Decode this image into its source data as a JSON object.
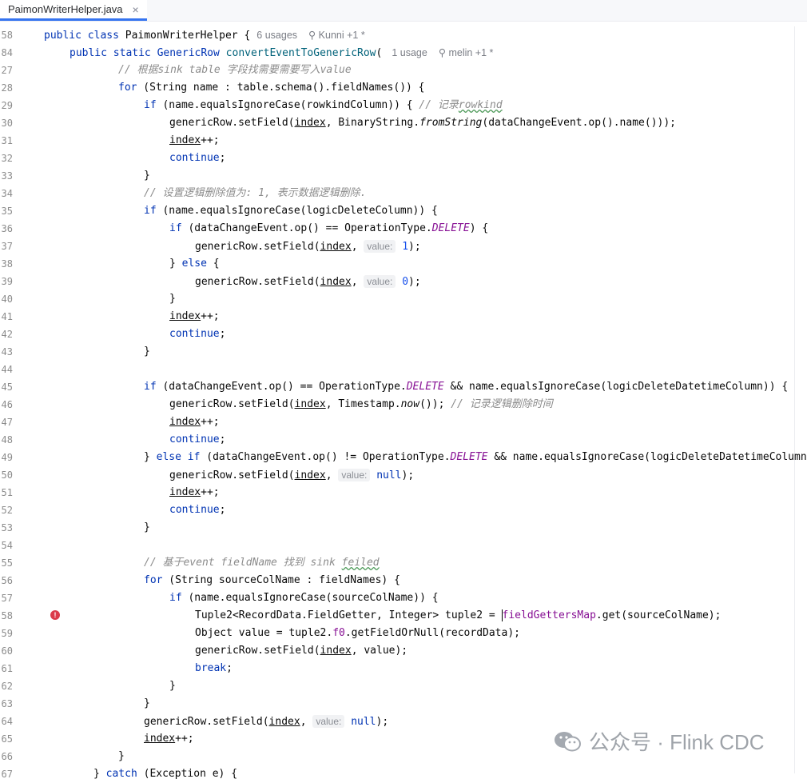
{
  "editor": {
    "tab": {
      "file_name": "PaimonWriterHelper.java",
      "close": "×"
    },
    "sticky": [
      {
        "ln": "58",
        "pre": "public class ",
        "name": "PaimonWriterHelper",
        "post": " {",
        "usages": "6 usages",
        "authors": "Kunni +1 *"
      },
      {
        "ln": "84",
        "pre": "public static GenericRow ",
        "name": "convertEventToGenericRow",
        "post": "(",
        "usages": "1 usage",
        "authors": "melin +1 *"
      }
    ],
    "lines": [
      {
        "ln": "27",
        "t": "// 根据sink table 字段找需要需要写入value"
      },
      {
        "ln": "28",
        "t": "for (String name : table.schema().fieldNames()) {"
      },
      {
        "ln": "29",
        "t": "if (name.equalsIgnoreCase(rowkindColumn)) { // 记录rowkind"
      },
      {
        "ln": "30",
        "t": "genericRow.setField(index, BinaryString.fromString(dataChangeEvent.op().name()));"
      },
      {
        "ln": "31",
        "t": "index++;"
      },
      {
        "ln": "32",
        "t": "continue;"
      },
      {
        "ln": "33",
        "t": "}"
      },
      {
        "ln": "34",
        "t": "// 设置逻辑删除值为: 1, 表示数据逻辑删除."
      },
      {
        "ln": "35",
        "t": "if (name.equalsIgnoreCase(logicDeleteColumn)) {"
      },
      {
        "ln": "36",
        "t": "if (dataChangeEvent.op() == OperationType.DELETE) {"
      },
      {
        "ln": "37",
        "t": "genericRow.setField(index, value: 1);"
      },
      {
        "ln": "38",
        "t": "} else {"
      },
      {
        "ln": "39",
        "t": "genericRow.setField(index, value: 0);"
      },
      {
        "ln": "40",
        "t": "}"
      },
      {
        "ln": "41",
        "t": "index++;"
      },
      {
        "ln": "42",
        "t": "continue;"
      },
      {
        "ln": "43",
        "t": "}"
      },
      {
        "ln": "44",
        "t": ""
      },
      {
        "ln": "45",
        "t": "if (dataChangeEvent.op() == OperationType.DELETE && name.equalsIgnoreCase(logicDeleteDatetimeColumn)) {"
      },
      {
        "ln": "46",
        "t": "genericRow.setField(index, Timestamp.now()); // 记录逻辑删除时间"
      },
      {
        "ln": "47",
        "t": "index++;"
      },
      {
        "ln": "48",
        "t": "continue;"
      },
      {
        "ln": "49",
        "t": "} else if (dataChangeEvent.op() != OperationType.DELETE && name.equalsIgnoreCase(logicDeleteDatetimeColumn"
      },
      {
        "ln": "50",
        "t": "genericRow.setField(index, value: null);"
      },
      {
        "ln": "51",
        "t": "index++;"
      },
      {
        "ln": "52",
        "t": "continue;"
      },
      {
        "ln": "53",
        "t": "}"
      },
      {
        "ln": "54",
        "t": ""
      },
      {
        "ln": "55",
        "t": "// 基于event fieldName 找到 sink feiled"
      },
      {
        "ln": "56",
        "t": "for (String sourceColName : fieldNames) {"
      },
      {
        "ln": "57",
        "t": "if (name.equalsIgnoreCase(sourceColName)) {"
      },
      {
        "ln": "58",
        "t": "Tuple2<RecordData.FieldGetter, Integer> tuple2 = fieldGettersMap.get(sourceColName);"
      },
      {
        "ln": "59",
        "t": "Object value = tuple2.f0.getFieldOrNull(recordData);"
      },
      {
        "ln": "60",
        "t": "genericRow.setField(index, value);"
      },
      {
        "ln": "61",
        "t": "break;"
      },
      {
        "ln": "62",
        "t": "}"
      },
      {
        "ln": "63",
        "t": "}"
      },
      {
        "ln": "64",
        "t": "genericRow.setField(index, value: null);"
      },
      {
        "ln": "65",
        "t": "index++;"
      },
      {
        "ln": "66",
        "t": "}"
      },
      {
        "ln": "67",
        "t": "} catch (Exception e) {"
      }
    ],
    "error_line": "58",
    "error_marker": "!"
  },
  "watermark": {
    "text": "公众号 · Flink CDC"
  },
  "colors": {
    "keyword": "#0033b3",
    "method": "#00627a",
    "number": "#1750eb",
    "constant": "#871094",
    "comment": "#8c8c8c",
    "error": "#db3b4b"
  }
}
